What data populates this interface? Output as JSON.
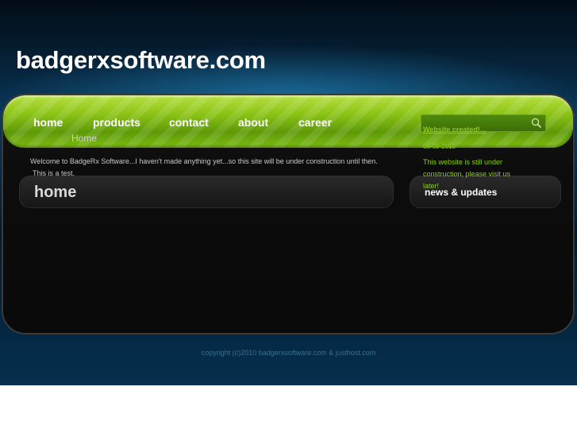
{
  "site": {
    "title": "badgerxsoftware.com"
  },
  "nav": {
    "items": [
      {
        "label": "home"
      },
      {
        "label": "products"
      },
      {
        "label": "contact"
      },
      {
        "label": "about"
      },
      {
        "label": "career"
      }
    ],
    "search": {
      "value": "",
      "placeholder": "",
      "icon": "search-icon"
    }
  },
  "main": {
    "panel_title": "home",
    "heading": "Home",
    "paragraph_1": "Welcome to BadgeRx Software...I haven't made anything yet...so this site will be under construction until then.",
    "paragraph_2": "This is a test."
  },
  "news": {
    "title": "news & updates",
    "item": {
      "headline": "Website created!...",
      "date": "08-09-2010",
      "text": "This website is still under construction, please visit us later!"
    }
  },
  "footer": {
    "copyright": "copyright (c)2010 badgerxsoftware.com & justhost.com"
  },
  "colors": {
    "accent_green": "#8ccc1c",
    "nav_green": "#7cbb12",
    "background_blue": "#0a3a5c"
  }
}
